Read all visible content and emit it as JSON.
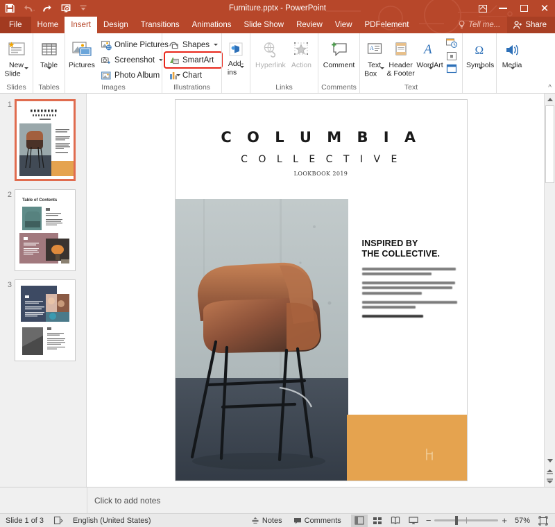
{
  "window": {
    "title": "Furniture.pptx - PowerPoint",
    "quick_access": [
      {
        "name": "save-icon",
        "label": "Save"
      },
      {
        "name": "undo-icon",
        "label": "Undo"
      },
      {
        "name": "redo-icon",
        "label": "Redo"
      },
      {
        "name": "start-from-beginning-icon",
        "label": "Start From Beginning"
      },
      {
        "name": "customize-quick-access-toolbar-icon",
        "label": "Customize Quick Access Toolbar"
      }
    ],
    "controls": {
      "ribbon_display_options": "Ribbon Display Options",
      "minimize": "Minimize",
      "restore": "Restore Down",
      "close": "Close"
    }
  },
  "tabs": [
    {
      "label": "File",
      "active": false,
      "file": true
    },
    {
      "label": "Home",
      "active": false
    },
    {
      "label": "Insert",
      "active": true
    },
    {
      "label": "Design",
      "active": false
    },
    {
      "label": "Transitions",
      "active": false
    },
    {
      "label": "Animations",
      "active": false
    },
    {
      "label": "Slide Show",
      "active": false
    },
    {
      "label": "Review",
      "active": false
    },
    {
      "label": "View",
      "active": false
    },
    {
      "label": "PDFelement",
      "active": false
    }
  ],
  "tell_me": {
    "label": "Tell me...",
    "icon": "lightbulb-icon"
  },
  "share": {
    "label": "Share",
    "icon": "share-person-icon"
  },
  "ribbon": {
    "collapse_label": "Collapse the Ribbon",
    "groups": [
      {
        "name": "slides",
        "label": "Slides",
        "buttons": [
          {
            "label": "New\nSlide",
            "label_line1": "New",
            "label_line2": "Slide",
            "icon": "new-slide-icon",
            "has_caret": true
          }
        ]
      },
      {
        "name": "tables",
        "label": "Tables",
        "buttons": [
          {
            "label_line1": "Table",
            "label_line2": "",
            "icon": "table-icon",
            "has_caret": true
          }
        ]
      },
      {
        "name": "images",
        "label": "Images",
        "buttons": [
          {
            "label_line1": "Pictures",
            "label_line2": "",
            "icon": "pictures-icon",
            "has_caret": false
          }
        ],
        "small_buttons": [
          {
            "label": "Online Pictures",
            "icon": "online-pictures-icon",
            "has_caret": false
          },
          {
            "label": "Screenshot",
            "icon": "screenshot-icon",
            "has_caret": true
          },
          {
            "label": "Photo Album",
            "icon": "photo-album-icon",
            "has_caret": true
          }
        ]
      },
      {
        "name": "illustrations",
        "label": "Illustrations",
        "small_buttons": [
          {
            "label": "Shapes",
            "icon": "shapes-icon",
            "has_caret": true,
            "highlighted": false
          },
          {
            "label": "SmartArt",
            "icon": "smartart-icon",
            "has_caret": false,
            "highlighted": true
          },
          {
            "label": "Chart",
            "icon": "chart-icon",
            "has_caret": false,
            "highlighted": false
          }
        ]
      },
      {
        "name": "add-ins",
        "label": "",
        "buttons": [
          {
            "label_line1": "Add-",
            "label_line2": "ins",
            "icon": "add-ins-icon",
            "has_caret": true
          }
        ]
      },
      {
        "name": "links",
        "label": "Links",
        "buttons": [
          {
            "label_line1": "Hyperlink",
            "label_line2": "",
            "icon": "hyperlink-icon",
            "disabled": true
          },
          {
            "label_line1": "Action",
            "label_line2": "",
            "icon": "action-icon",
            "disabled": true
          }
        ]
      },
      {
        "name": "comments",
        "label": "Comments",
        "buttons": [
          {
            "label_line1": "Comment",
            "label_line2": "",
            "icon": "comment-icon"
          }
        ]
      },
      {
        "name": "text",
        "label": "Text",
        "buttons": [
          {
            "label_line1": "Text",
            "label_line2": "Box",
            "icon": "text-box-icon",
            "has_caret": true
          },
          {
            "label_line1": "Header",
            "label_line2": "& Footer",
            "icon": "header-footer-icon"
          },
          {
            "label_line1": "WordArt",
            "label_line2": "",
            "icon": "wordart-icon",
            "has_caret": true
          }
        ],
        "stack_icons": [
          {
            "name": "date-and-time-icon"
          },
          {
            "name": "slide-number-icon"
          },
          {
            "name": "object-icon"
          }
        ]
      },
      {
        "name": "symbols",
        "label": "",
        "buttons": [
          {
            "label_line1": "Symbols",
            "label_line2": "",
            "icon": "omega-symbols-icon",
            "has_caret": true
          }
        ]
      },
      {
        "name": "media",
        "label": "",
        "buttons": [
          {
            "label_line1": "Media",
            "label_line2": "",
            "icon": "media-speaker-icon",
            "has_caret": true
          }
        ]
      }
    ]
  },
  "thumbnails": [
    {
      "number": "1",
      "selected": true,
      "title": "COLUMBIA COLLECTIVE",
      "layout": "title"
    },
    {
      "number": "2",
      "selected": false,
      "title": "Table of Contents",
      "layout": "toc"
    },
    {
      "number": "3",
      "selected": false,
      "title": "",
      "layout": "content"
    }
  ],
  "slide": {
    "title": "C O L U M B I A",
    "subtitle": "C O L L E C T I V E",
    "lookbook": "LOOKBOOK 2019",
    "heading_line1": "INSPIRED BY",
    "heading_line2": "THE COLLECTIVE.",
    "body_paragraphs": [
      {
        "lines": [
          0.97,
          0.72
        ],
        "bold": false
      },
      {
        "lines": [
          0.96,
          0.93,
          0.62
        ],
        "bold": false
      },
      {
        "lines": [
          0.98,
          0.55
        ],
        "bold": false
      },
      {
        "lines": [
          0.63
        ],
        "bold": true
      }
    ],
    "image_alt": "tan leather bar stool chair on concrete floor",
    "footer_icon": "chair-icon"
  },
  "colors": {
    "ribbon_accent": "#b7472a",
    "slide_orange": "#e5a34f",
    "highlight_red": "#e8261a",
    "selection_border": "#e06c4f",
    "chair_brown": "#a65c3c",
    "wall_gray": "#b9c2c2",
    "floor_slate": "#3d4550",
    "thumb2_mauve": "#a2797e",
    "thumb2_teal": "#5e8b88",
    "thumb3_navy": "#3d4a63"
  },
  "notes": {
    "placeholder": "Click to add notes"
  },
  "status": {
    "slide_indicator": "Slide 1 of 3",
    "accessibility_icon": "accessibility-checker-icon",
    "language": "English (United States)",
    "notes_label": "Notes",
    "notes_icon": "notes-icon",
    "comments_label": "Comments",
    "comments_icon": "comments-icon",
    "views": [
      {
        "name": "normal-view",
        "active": true
      },
      {
        "name": "slide-sorter-view",
        "active": false
      },
      {
        "name": "reading-view",
        "active": false
      },
      {
        "name": "slide-show-view",
        "active": false
      }
    ],
    "zoom_out": "−",
    "zoom_in": "+",
    "zoom_level": "57%",
    "fit_to_window_icon": "fit-slide-to-window-icon"
  },
  "scrollbar": {
    "up_arrow": "scroll-up-icon",
    "down_arrow": "scroll-down-icon",
    "previous_slide": "previous-slide-icon",
    "next_slide": "next-slide-icon"
  }
}
